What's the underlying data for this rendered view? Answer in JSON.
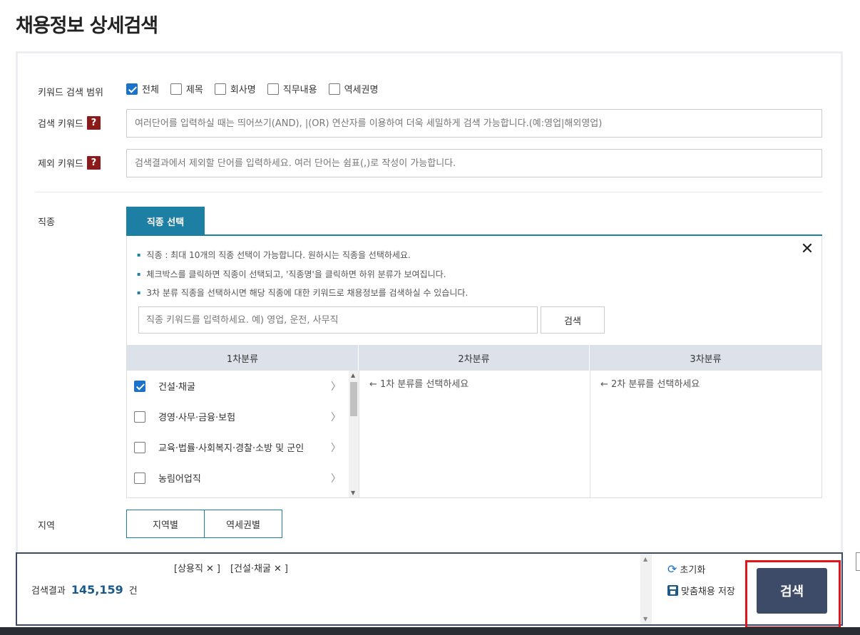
{
  "page": {
    "title": "채용정보 상세검색"
  },
  "keyword_scope": {
    "label": "키워드 검색 범위",
    "options": [
      {
        "label": "전체",
        "checked": true
      },
      {
        "label": "제목",
        "checked": false
      },
      {
        "label": "회사명",
        "checked": false
      },
      {
        "label": "직무내용",
        "checked": false
      },
      {
        "label": "역세권명",
        "checked": false
      }
    ]
  },
  "search_keyword": {
    "label": "검색 키워드",
    "help": "?",
    "placeholder": "여러단어를 입력하실 때는 띄어쓰기(AND), |(OR) 연산자를 이용하여 더욱 세밀하게 검색 가능합니다.(예:영업|해외영업)"
  },
  "exclude_keyword": {
    "label": "제외 키워드",
    "help": "?",
    "placeholder": "검색결과에서 제외할 단어를 입력하세요. 여러 단어는 쉼표(,)로 작성이 가능합니다."
  },
  "job_type": {
    "label": "직종",
    "tab_label": "직종 선택",
    "close": "✕",
    "notes": [
      "직종 : 최대 10개의 직종 선택이 가능합니다. 원하시는 직종을 선택하세요.",
      "체크박스를 클릭하면 직종이 선택되고, '직종명'을 클릭하면 하위 분류가 보여집니다.",
      "3차 분류 직종을 선택하시면 해당 직종에 대한 키워드로 채용정보를 검색하실 수 있습니다."
    ],
    "search_placeholder": "직종 키워드를 입력하세요. 예) 영업, 운전, 사무직",
    "search_button": "검색",
    "columns": [
      "1차분류",
      "2차분류",
      "3차분류"
    ],
    "categories": [
      {
        "label": "건설·채굴",
        "checked": true
      },
      {
        "label": "경영·사무·금융·보험",
        "checked": false
      },
      {
        "label": "교육·법률·사회복지·경찰·소방 및 군인",
        "checked": false
      },
      {
        "label": "농림어업직",
        "checked": false
      }
    ],
    "hint_2nd": "← 1차 분류를 선택하세요",
    "hint_3rd": "← 2차 분류를 선택하세요"
  },
  "region": {
    "label": "지역",
    "tabs": [
      "지역별",
      "역세권별"
    ]
  },
  "bottom": {
    "tags": [
      "[상용직",
      "]",
      "[건설·채굴",
      "]"
    ],
    "result_label": "검색결과",
    "result_count": "145,159",
    "result_unit": "건",
    "reset_label": "초기화",
    "save_label": "맞춤채용 저장",
    "search_button": "검색"
  },
  "colors": {
    "accent": "#1e7fa5",
    "primary_dark": "#3d4a68",
    "highlight": "#e0161b",
    "check": "#1a73c9"
  }
}
